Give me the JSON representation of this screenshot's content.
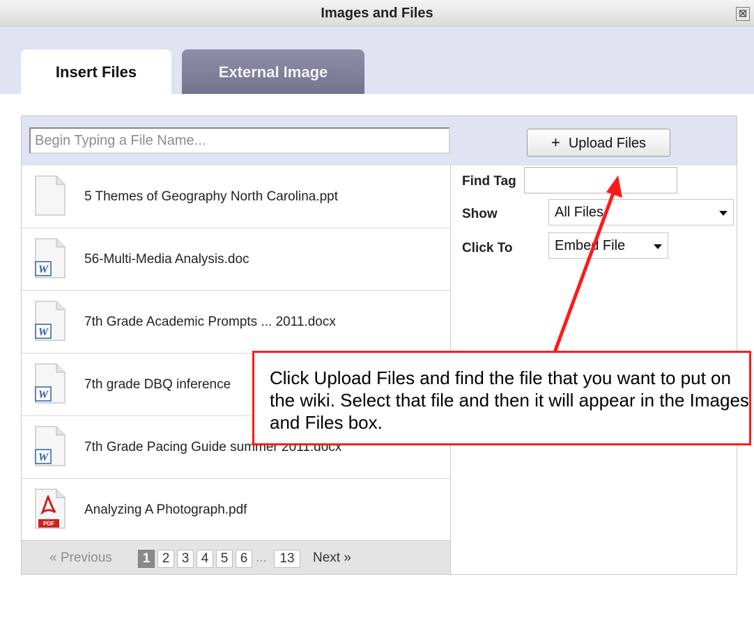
{
  "dialog": {
    "title": "Images and Files",
    "close_symbol": "⊠"
  },
  "tabs": [
    {
      "label": "Insert Files",
      "active": true
    },
    {
      "label": "External Image",
      "active": false
    }
  ],
  "search": {
    "placeholder": "Begin Typing a File Name..."
  },
  "upload": {
    "plus": "+",
    "label": "Upload Files"
  },
  "files": [
    {
      "name": "5 Themes of Geography North Carolina.ppt",
      "icon": "blank-document-icon"
    },
    {
      "name": "56-Multi-Media Analysis.doc",
      "icon": "word-document-icon"
    },
    {
      "name": "7th Grade Academic Prompts ... 2011.docx",
      "icon": "word-document-icon"
    },
    {
      "name": "7th grade DBQ inference",
      "icon": "word-document-icon"
    },
    {
      "name": "7th Grade Pacing Guide summer 2011.docx",
      "icon": "word-document-icon"
    },
    {
      "name": "Analyzing A Photograph.pdf",
      "icon": "pdf-document-icon"
    }
  ],
  "options": {
    "find_tag_label": "Find Tag",
    "find_tag_value": "",
    "show_label": "Show",
    "show_value": "All Files",
    "click_to_label": "Click To",
    "click_to_value": "Embed File"
  },
  "pagination": {
    "previous": "« Previous",
    "pages": [
      "1",
      "2",
      "3",
      "4",
      "5",
      "6"
    ],
    "ellipsis": "...",
    "last": "13",
    "next": "Next »",
    "current": "1"
  },
  "callout": {
    "text": "Click Upload Files and find the file that you want to put on the wiki.  Select that file and then it will appear in the Images and Files box."
  },
  "colors": {
    "callout_border": "#ff1a1a",
    "tab_strip": "#dfe3f2",
    "inactive_tab": "#7c7b96"
  }
}
